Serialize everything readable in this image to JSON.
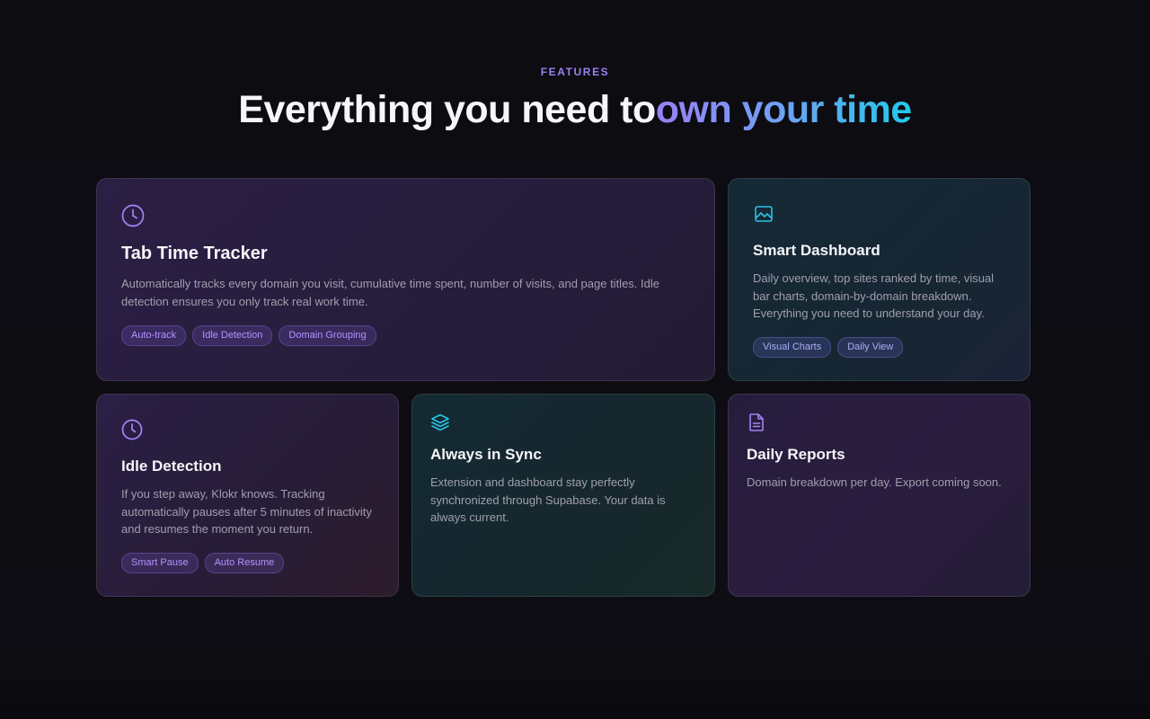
{
  "section": {
    "eyebrow": "FEATURES",
    "headline_prefix": "Everything you need to",
    "headline_highlight": "own your time"
  },
  "cards": {
    "tracker": {
      "icon": "clock-icon",
      "title": "Tab Time Tracker",
      "description": "Automatically tracks every domain you visit, cumulative time spent, number of visits, and page titles. Idle detection ensures you only track real work time.",
      "tags": [
        "Auto-track",
        "Idle Detection",
        "Domain Grouping"
      ]
    },
    "dashboard": {
      "icon": "image-chart-icon",
      "title": "Smart Dashboard",
      "description": "Daily overview, top sites ranked by time, visual bar charts, domain-by-domain breakdown. Everything you need to understand your day.",
      "tags": [
        "Visual Charts",
        "Daily View"
      ]
    },
    "idle": {
      "icon": "clock-icon",
      "title": "Idle Detection",
      "description": "If you step away, Klokr knows. Tracking automatically pauses after 5 minutes of inactivity and resumes the moment you return.",
      "tags": [
        "Smart Pause",
        "Auto Resume"
      ]
    },
    "sync": {
      "icon": "layers-icon",
      "title": "Always in Sync",
      "description": "Extension and dashboard stay perfectly synchronized through Supabase. Your data is always current."
    },
    "reports": {
      "icon": "document-icon",
      "title": "Daily Reports",
      "description": "Domain breakdown per day. Export coming soon."
    }
  },
  "colors": {
    "accent_purple": "#9d7ff0",
    "accent_cyan": "#22c8ea",
    "background": "#0c0c11"
  }
}
